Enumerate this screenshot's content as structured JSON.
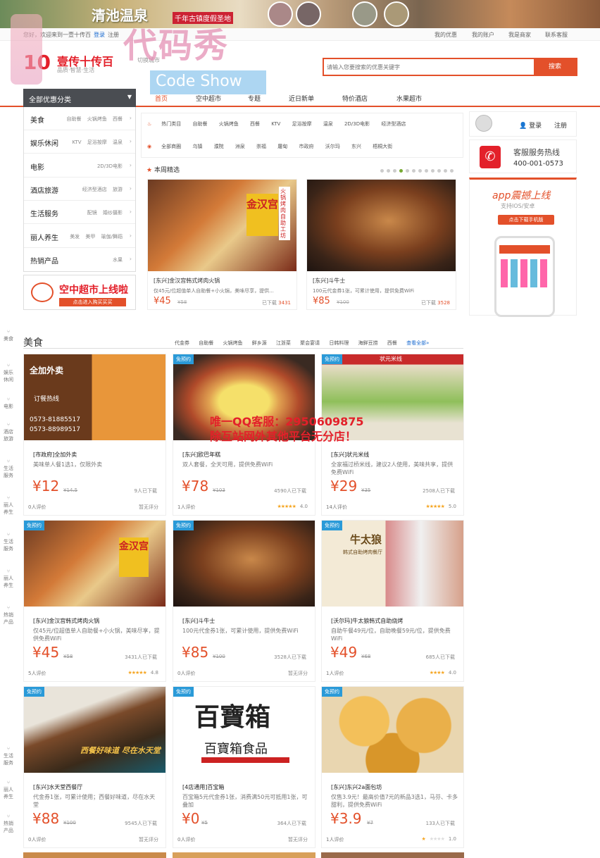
{
  "banner": {
    "title": "清池温泉",
    "subtitle": "千年古镇度假圣地"
  },
  "topbar": {
    "welcome": "您好，欢迎来到一壹十传百",
    "login": "登录",
    "register": "注册",
    "links": [
      "我的优惠",
      "我的账户",
      "我是商家",
      "联系客服"
    ]
  },
  "watermark": {
    "text": "代码秀",
    "code_show": "Code Show"
  },
  "logo": {
    "mark": "10",
    "name": "壹传十传百",
    "slogan": "品质·智慧·生活"
  },
  "city": "切换城市",
  "search": {
    "placeholder": "请输入您要搜索的优惠关键字",
    "button": "搜索"
  },
  "nav": {
    "category_head": "全部优惠分类",
    "items": [
      "首页",
      "空中超市",
      "专题",
      "近日新单",
      "特价酒店",
      "水果超市"
    ]
  },
  "categories": [
    {
      "main": "美食",
      "subs": "自助餐 火锅烤鱼 西餐"
    },
    {
      "main": "娱乐休闲",
      "subs": "KTV 足浴按摩 温泉"
    },
    {
      "main": "电影",
      "subs": "2D/3D电影"
    },
    {
      "main": "酒店旅游",
      "subs": "经济型酒店 旅游"
    },
    {
      "main": "生活服务",
      "subs": "配镜 婚纱摄影"
    },
    {
      "main": "丽人养生",
      "subs": "美发 美甲 瑜伽/舞蹈"
    },
    {
      "main": "热销产品",
      "subs": "水果"
    }
  ],
  "promo_left": {
    "title": "空中超市上线啦",
    "button": "点击进入购买买买"
  },
  "filters": {
    "hot_label": "热门类目",
    "hot": [
      "自助餐",
      "火锅烤鱼",
      "西餐",
      "KTV",
      "足浴按摩",
      "温泉",
      "2D/3D电影",
      "经济型酒店"
    ],
    "area_label": "全部商圈",
    "areas": [
      "乌镇",
      "濮院",
      "洲泉",
      "崇福",
      "屠甸",
      "市政府",
      "沃尔玛",
      "东兴",
      "梧桐大街"
    ]
  },
  "weekly": {
    "title": "本周精选"
  },
  "featured": [
    {
      "title": "[东兴]金汉宫韩式烤肉火锅",
      "desc": "仅45元/位超值单人自助餐+小火锅，美味尽享，提供...",
      "price": "¥45",
      "orig": "¥58",
      "count": "已下载",
      "count_num": "3431",
      "img_text": "金汉宫",
      "img_side": "火锅烤肉自助工坊"
    },
    {
      "title": "[东兴]斗牛士",
      "desc": "100元代金券1张，可累计使用，提供免费WiFi",
      "price": "¥85",
      "orig": "¥100",
      "count": "已下载",
      "count_num": "3528",
      "img_text": ""
    }
  ],
  "user": {
    "login": "登录",
    "register": "注册"
  },
  "service": {
    "label": "客服服务热线",
    "phone": "400-001-0573"
  },
  "app": {
    "title": "app震撼上线",
    "sub": "支持IOS/安卓",
    "button": "点击下载手机版"
  },
  "side_nav": [
    "美食",
    "娱乐休闲",
    "电影",
    "酒店旅游",
    "生活服务",
    "丽人养生",
    "热销产品",
    "生活服务",
    "丽人养生",
    "热销产品"
  ],
  "section": {
    "title": "美食",
    "tags": [
      "代金券",
      "自助餐",
      "火锅烤鱼",
      "鲜乡源",
      "江浙菜",
      "聚会宴请",
      "日韩料理",
      "海鲜豆捞",
      "西餐"
    ],
    "more": "查看全部»"
  },
  "qq_notice": {
    "line1": "唯一QQ客服：2950609875",
    "line2": "除互站网外其他平台无分店！"
  },
  "deals": [
    {
      "tag": "",
      "title": "[市政府]全加外卖",
      "desc": "美味单人餐1选1，仅限外卖",
      "price": "¥12",
      "orig": "¥14.5",
      "count": "9人已下载",
      "reviews": "0人评价",
      "rating": "暂无评分",
      "stars": 0,
      "img": "全加外卖",
      "img_sub": "订餐热线",
      "img_phones": "0573-81885517 0573-88989517"
    },
    {
      "tag": "免预约",
      "title": "[东兴]欧巴年糕",
      "desc": "双人套餐，全天可用，提供免费WiFi",
      "price": "¥78",
      "orig": "¥103",
      "count": "4590人已下载",
      "reviews": "1人评价",
      "rating": "4.0",
      "stars": 5
    },
    {
      "tag": "免预约",
      "title": "[东兴]状元米线",
      "desc": "全家福过桥米线，建议2人使用，美味共享，提供免费WiFi",
      "price": "¥29",
      "orig": "¥35",
      "count": "2508人已下载",
      "reviews": "14人评价",
      "rating": "5.0",
      "stars": 5,
      "img": "状元米线"
    },
    {
      "tag": "免预约",
      "title": "[东兴]金汉宫韩式烤肉火锅",
      "desc": "仅45元/位超值单人自助餐+小火锅，美味尽享，提供免费WiFi",
      "price": "¥45",
      "orig": "¥58",
      "count": "3431人已下载",
      "reviews": "5人评价",
      "rating": "4.8",
      "stars": 5,
      "img": "金汉宫"
    },
    {
      "tag": "免预约",
      "title": "[东兴]斗牛士",
      "desc": "100元代金券1张，可累计使用，提供免费WiFi",
      "price": "¥85",
      "orig": "¥100",
      "count": "3528人已下载",
      "reviews": "0人评价",
      "rating": "暂无评分",
      "stars": 0
    },
    {
      "tag": "免预约",
      "title": "[沃尔玛]牛太狼韩式自助烧烤",
      "desc": "自助午餐49元/位，自助晚餐59元/位，提供免费WiFi",
      "price": "¥49",
      "orig": "¥68",
      "count": "685人已下载",
      "reviews": "1人评价",
      "rating": "4.0",
      "stars": 4,
      "img": "牛太狼",
      "img_sub": "韩式自助烤肉餐厅"
    },
    {
      "tag": "免预约",
      "title": "[东兴]水天堂西餐厅",
      "desc": "代金券1张，可累计使用；西餐好味道，尽在水天堂",
      "price": "¥88",
      "orig": "¥100",
      "count": "9545人已下载",
      "reviews": "0人评价",
      "rating": "暂无评分",
      "stars": 0,
      "img": "西餐好味道 尽在水天堂"
    },
    {
      "tag": "免预约",
      "title": "[4店通用]百宝箱",
      "desc": "百宝箱5元代金券1张，消费满50元可抵用1张，可叠加",
      "price": "¥0",
      "orig": "¥5",
      "count": "364人已下载",
      "reviews": "0人评价",
      "rating": "暂无评分",
      "stars": 0,
      "img": "百寶箱",
      "img_sub": "百寶箱食品"
    },
    {
      "tag": "免预约",
      "title": "[东兴]东兴2a面包坊",
      "desc": "仅售3.9元！最高价值7元的新品3选1，马芬、卡多甜利，提供免费WiFi",
      "price": "¥3.9",
      "orig": "¥7",
      "count": "133人已下载",
      "reviews": "1人评价",
      "rating": "1.0",
      "stars": 1
    }
  ]
}
